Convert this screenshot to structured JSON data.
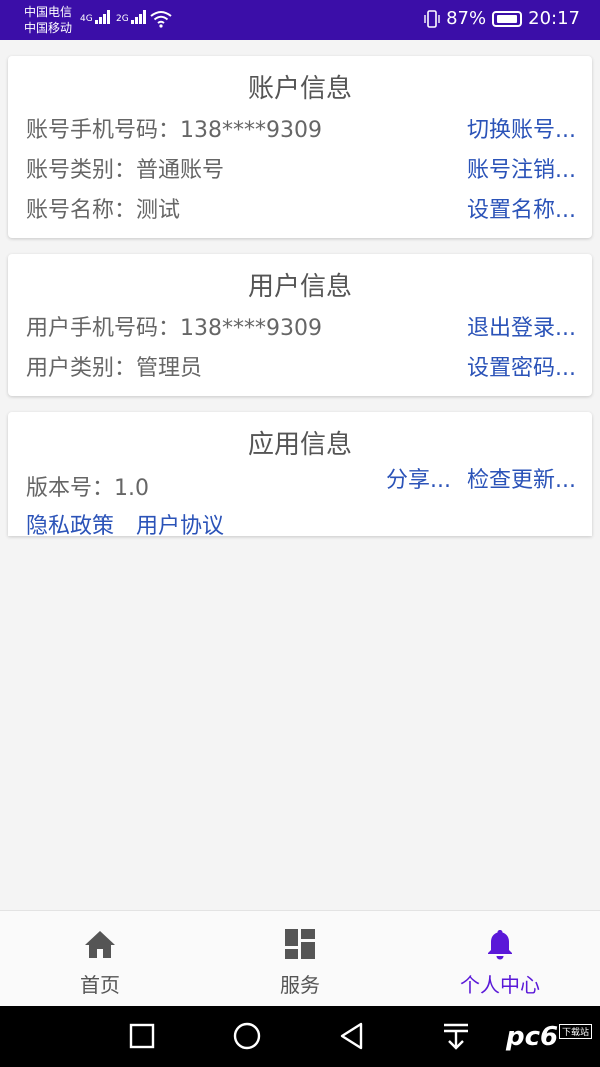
{
  "status_bar": {
    "carrier_1": "中国电信",
    "carrier_2": "中国移动",
    "net_1": "4G",
    "net_2": "2G",
    "battery": "87%",
    "time": "20:17"
  },
  "account_card": {
    "title": "账户信息",
    "phone_label": "账号手机号码：138****9309",
    "type_label": "账号类别：普通账号",
    "name_label": "账号名称：测试",
    "switch_link": "切换账号...",
    "cancel_link": "账号注销...",
    "setname_link": "设置名称..."
  },
  "user_card": {
    "title": "用户信息",
    "phone_label": "用户手机号码：138****9309",
    "type_label": "用户类别：管理员",
    "logout_link": "退出登录...",
    "password_link": "设置密码..."
  },
  "app_card": {
    "title": "应用信息",
    "version_label": "版本号：1.0",
    "share_link": "分享...",
    "update_link": "检查更新...",
    "privacy_link": "隐私政策",
    "agreement_link": "用户协议"
  },
  "bottom_nav": {
    "items": [
      {
        "label": "首页",
        "icon": "home-icon"
      },
      {
        "label": "服务",
        "icon": "grid-icon"
      },
      {
        "label": "个人中心",
        "icon": "bell-icon"
      }
    ],
    "active_index": 2
  },
  "watermark": {
    "text": "pc6",
    "badge": "下载站"
  },
  "colors": {
    "status_bar": "#3b0ea8",
    "link": "#2b53b8",
    "active_nav": "#5a18d8"
  }
}
